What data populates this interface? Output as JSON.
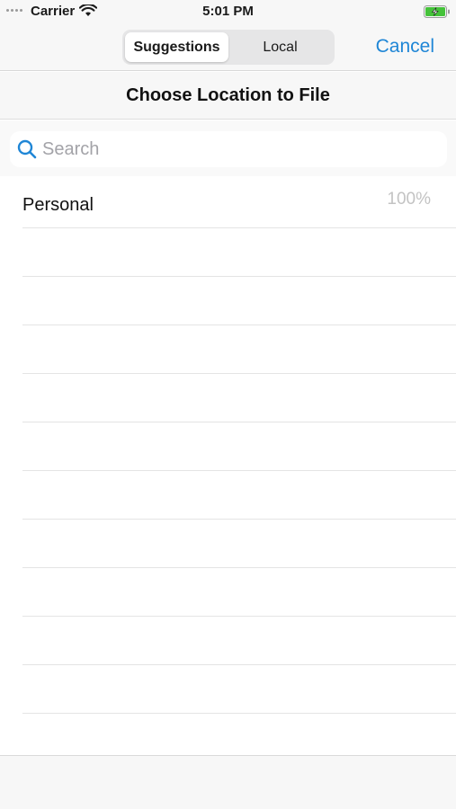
{
  "status_bar": {
    "carrier": "Carrier",
    "time": "5:01 PM",
    "battery_color": "#45c23a"
  },
  "toolbar": {
    "segments": [
      "Suggestions",
      "Local"
    ],
    "selected_segment": "Suggestions",
    "cancel_label": "Cancel",
    "accent_color": "#1f86d6"
  },
  "header": {
    "title": "Choose Location to File"
  },
  "search": {
    "placeholder": "Search",
    "value": ""
  },
  "list": {
    "items": [
      {
        "label": "Personal",
        "match": "100%"
      }
    ]
  }
}
